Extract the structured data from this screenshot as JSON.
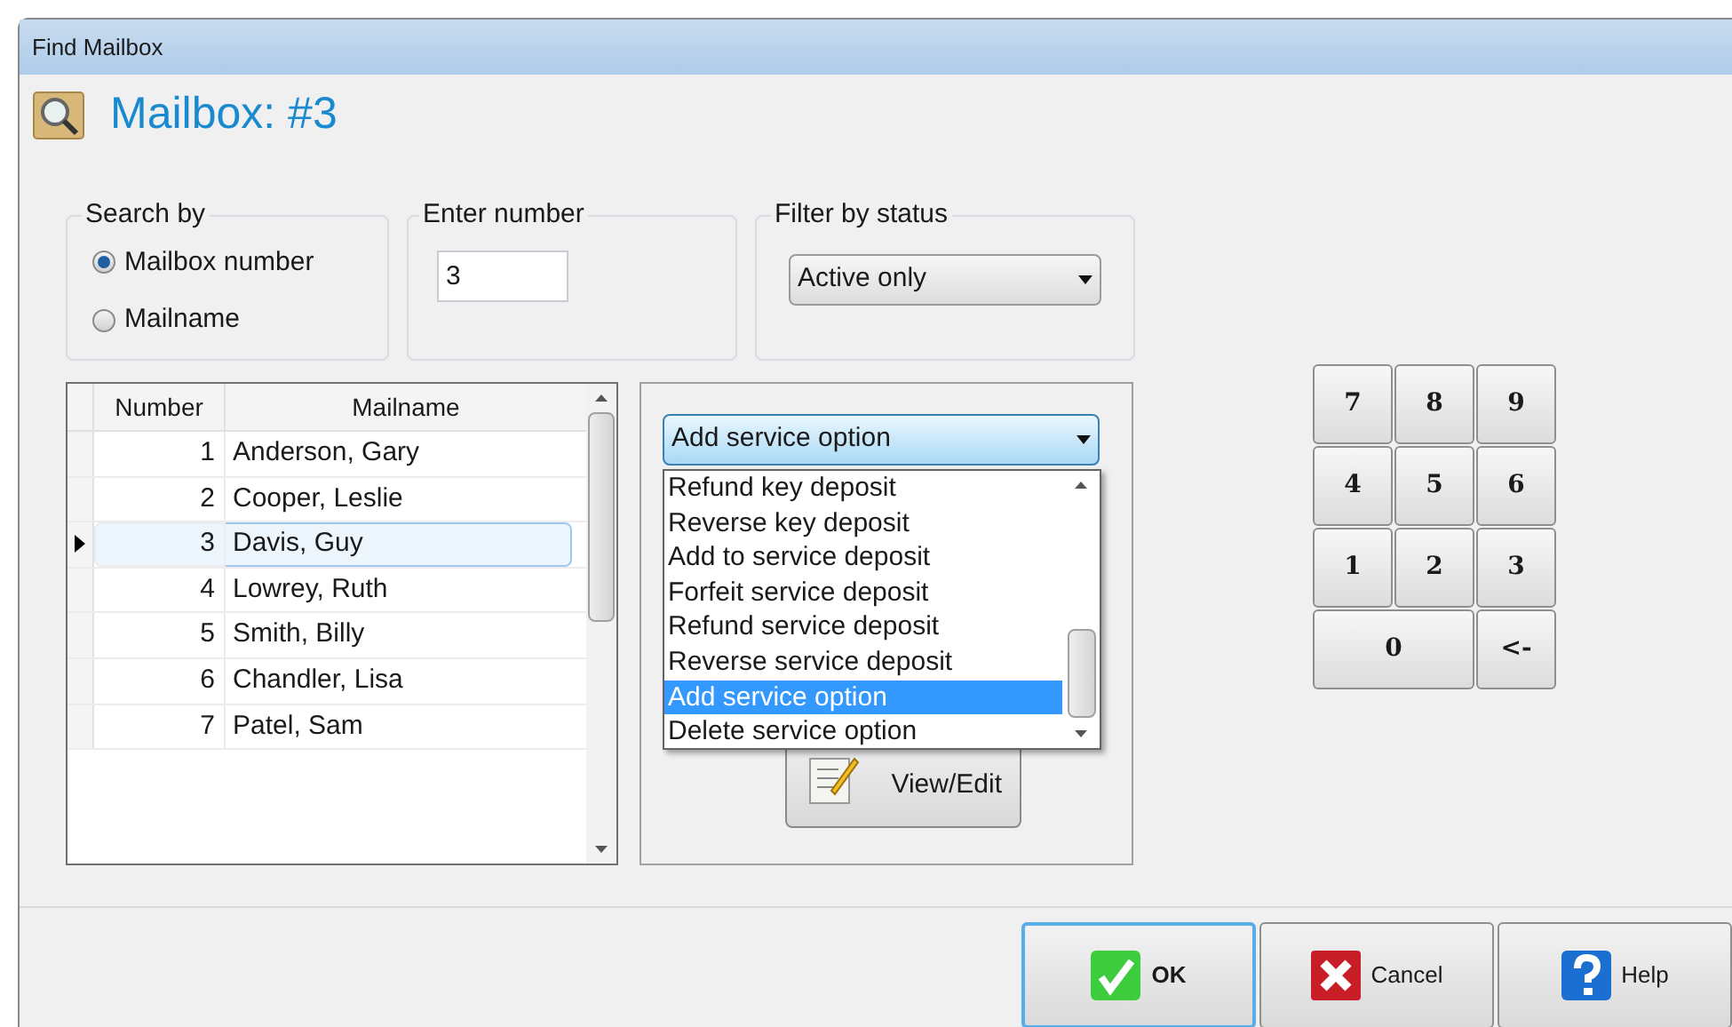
{
  "window": {
    "title": "Find Mailbox"
  },
  "header": {
    "title": "Mailbox: #3"
  },
  "search_by": {
    "label": "Search by",
    "options": [
      {
        "label": "Mailbox number",
        "selected": true
      },
      {
        "label": "Mailname",
        "selected": false
      }
    ]
  },
  "enter_number": {
    "label": "Enter number",
    "value": "3"
  },
  "filter": {
    "label": "Filter by status",
    "value": "Active only"
  },
  "table": {
    "columns": [
      "Number",
      "Mailname"
    ],
    "rows": [
      {
        "number": "1",
        "mailname": "Anderson, Gary",
        "selected": false
      },
      {
        "number": "2",
        "mailname": "Cooper, Leslie",
        "selected": false
      },
      {
        "number": "3",
        "mailname": "Davis, Guy",
        "selected": true
      },
      {
        "number": "4",
        "mailname": "Lowrey, Ruth",
        "selected": false
      },
      {
        "number": "5",
        "mailname": "Smith, Billy",
        "selected": false
      },
      {
        "number": "6",
        "mailname": "Chandler, Lisa",
        "selected": false
      },
      {
        "number": "7",
        "mailname": "Patel, Sam",
        "selected": false
      }
    ]
  },
  "action": {
    "value": "Add service option",
    "options": [
      {
        "label": "Refund key deposit",
        "selected": false
      },
      {
        "label": "Reverse key deposit",
        "selected": false
      },
      {
        "label": "Add to service deposit",
        "selected": false
      },
      {
        "label": "Forfeit service deposit",
        "selected": false
      },
      {
        "label": "Refund service deposit",
        "selected": false
      },
      {
        "label": "Reverse service deposit",
        "selected": false
      },
      {
        "label": "Add service option",
        "selected": true
      },
      {
        "label": "Delete service option",
        "selected": false
      }
    ]
  },
  "view_edit": {
    "label": "View/Edit"
  },
  "keypad": [
    {
      "label": "7",
      "wide": false
    },
    {
      "label": "8",
      "wide": false
    },
    {
      "label": "9",
      "wide": false
    },
    {
      "label": "4",
      "wide": false
    },
    {
      "label": "5",
      "wide": false
    },
    {
      "label": "6",
      "wide": false
    },
    {
      "label": "1",
      "wide": false
    },
    {
      "label": "2",
      "wide": false
    },
    {
      "label": "3",
      "wide": false
    },
    {
      "label": "0",
      "wide": true
    },
    {
      "label": "<-",
      "wide": false
    }
  ],
  "buttons": [
    {
      "label": "OK",
      "kind": "ok",
      "focused": true
    },
    {
      "label": "Cancel",
      "kind": "cancel",
      "focused": false
    },
    {
      "label": "Help",
      "kind": "help",
      "focused": false
    }
  ]
}
